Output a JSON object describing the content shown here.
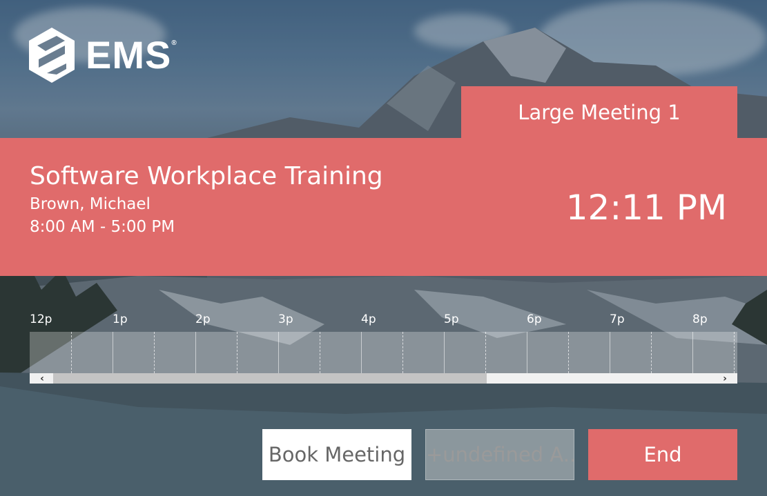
{
  "brand": {
    "logo_text": "EMS",
    "registered_mark": "®"
  },
  "room": {
    "name": "Large Meeting 1"
  },
  "meeting": {
    "title": "Software Workplace Training",
    "host": "Brown, Michael",
    "time_range": "8:00 AM - 5:00 PM"
  },
  "clock": {
    "time": "12:11 PM"
  },
  "timeline": {
    "hours": [
      "12p",
      "1p",
      "2p",
      "3p",
      "4p",
      "5p",
      "6p",
      "7p",
      "8p"
    ],
    "scroll_left_icon": "chevron-left-icon",
    "scroll_right_icon": "chevron-right-icon",
    "scroll_left_glyph": "‹",
    "scroll_right_glyph": "›"
  },
  "actions": {
    "book_label": "Book Meeting",
    "all_label": "+undefined A...",
    "end_label": "End"
  },
  "colors": {
    "accent": "#e06b6b",
    "button_light": "#ffffff",
    "text_light": "#ffffff"
  }
}
